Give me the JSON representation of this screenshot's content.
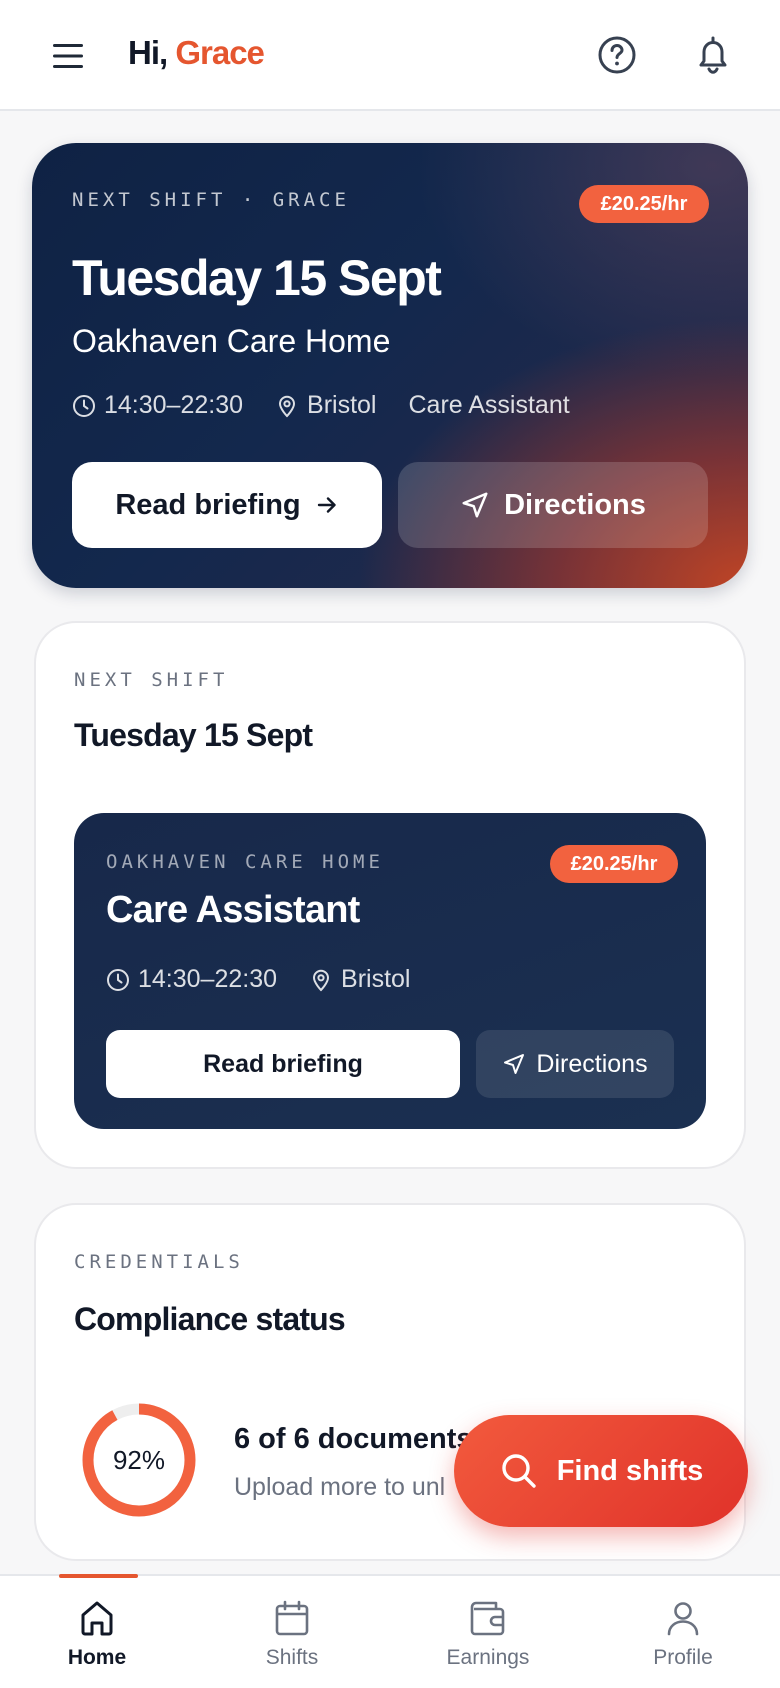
{
  "header": {
    "greeting_prefix": "Hi, ",
    "user_name": "Grace"
  },
  "hero": {
    "eyebrow": "NEXT SHIFT · GRACE",
    "rate": "£20.25/hr",
    "date": "Tuesday 15 Sept",
    "venue": "Oakhaven Care Home",
    "time": "14:30–22:30",
    "location": "Bristol",
    "role": "Care Assistant",
    "primary_button": "Read briefing",
    "secondary_button": "Directions"
  },
  "next_shift_card": {
    "eyebrow": "NEXT SHIFT",
    "heading": "Tuesday 15 Sept",
    "tile": {
      "eyebrow": "OAKHAVEN CARE HOME",
      "rate": "£20.25/hr",
      "role": "Care Assistant",
      "time": "14:30–22:30",
      "location": "Bristol",
      "primary_button": "Read briefing",
      "secondary_button": "Directions"
    }
  },
  "credentials_card": {
    "eyebrow": "CREDENTIALS",
    "heading": "Compliance status",
    "progress_percent": 92,
    "progress_label": "92%",
    "docs_title": "6 of 6 documents",
    "docs_subtitle": "Upload more to unl"
  },
  "fab": {
    "label": "Find shifts"
  },
  "bottom_nav": {
    "items": [
      {
        "label": "Home",
        "icon": "home-icon",
        "active": true
      },
      {
        "label": "Shifts",
        "icon": "calendar-icon",
        "active": false
      },
      {
        "label": "Earnings",
        "icon": "wallet-icon",
        "active": false
      },
      {
        "label": "Profile",
        "icon": "user-icon",
        "active": false
      }
    ]
  },
  "colors": {
    "accent": "#e5562f",
    "navy": "#17284a",
    "badge": "#f2623f"
  }
}
